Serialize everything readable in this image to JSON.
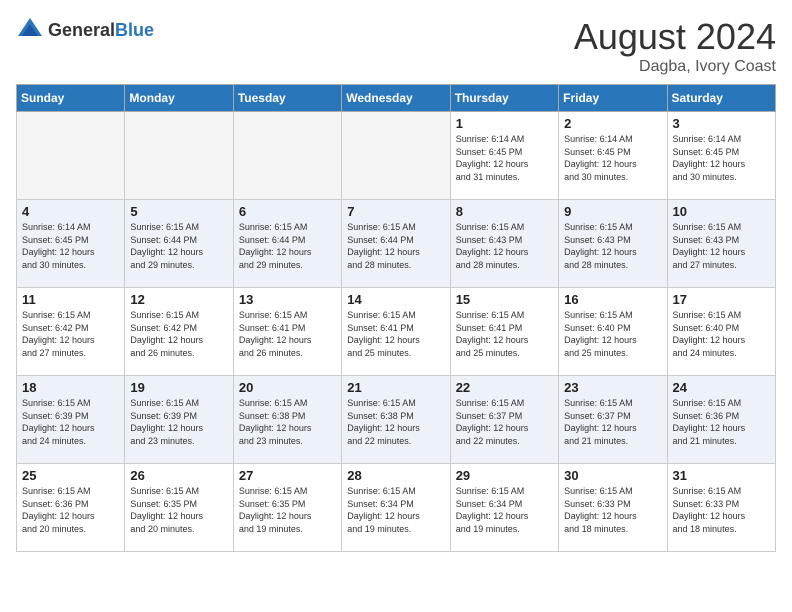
{
  "header": {
    "logo_general": "General",
    "logo_blue": "Blue",
    "month_year": "August 2024",
    "location": "Dagba, Ivory Coast"
  },
  "days_of_week": [
    "Sunday",
    "Monday",
    "Tuesday",
    "Wednesday",
    "Thursday",
    "Friday",
    "Saturday"
  ],
  "weeks": [
    [
      {
        "day": "",
        "info": ""
      },
      {
        "day": "",
        "info": ""
      },
      {
        "day": "",
        "info": ""
      },
      {
        "day": "",
        "info": ""
      },
      {
        "day": "1",
        "info": "Sunrise: 6:14 AM\nSunset: 6:45 PM\nDaylight: 12 hours\nand 31 minutes."
      },
      {
        "day": "2",
        "info": "Sunrise: 6:14 AM\nSunset: 6:45 PM\nDaylight: 12 hours\nand 30 minutes."
      },
      {
        "day": "3",
        "info": "Sunrise: 6:14 AM\nSunset: 6:45 PM\nDaylight: 12 hours\nand 30 minutes."
      }
    ],
    [
      {
        "day": "4",
        "info": "Sunrise: 6:14 AM\nSunset: 6:45 PM\nDaylight: 12 hours\nand 30 minutes."
      },
      {
        "day": "5",
        "info": "Sunrise: 6:15 AM\nSunset: 6:44 PM\nDaylight: 12 hours\nand 29 minutes."
      },
      {
        "day": "6",
        "info": "Sunrise: 6:15 AM\nSunset: 6:44 PM\nDaylight: 12 hours\nand 29 minutes."
      },
      {
        "day": "7",
        "info": "Sunrise: 6:15 AM\nSunset: 6:44 PM\nDaylight: 12 hours\nand 28 minutes."
      },
      {
        "day": "8",
        "info": "Sunrise: 6:15 AM\nSunset: 6:43 PM\nDaylight: 12 hours\nand 28 minutes."
      },
      {
        "day": "9",
        "info": "Sunrise: 6:15 AM\nSunset: 6:43 PM\nDaylight: 12 hours\nand 28 minutes."
      },
      {
        "day": "10",
        "info": "Sunrise: 6:15 AM\nSunset: 6:43 PM\nDaylight: 12 hours\nand 27 minutes."
      }
    ],
    [
      {
        "day": "11",
        "info": "Sunrise: 6:15 AM\nSunset: 6:42 PM\nDaylight: 12 hours\nand 27 minutes."
      },
      {
        "day": "12",
        "info": "Sunrise: 6:15 AM\nSunset: 6:42 PM\nDaylight: 12 hours\nand 26 minutes."
      },
      {
        "day": "13",
        "info": "Sunrise: 6:15 AM\nSunset: 6:41 PM\nDaylight: 12 hours\nand 26 minutes."
      },
      {
        "day": "14",
        "info": "Sunrise: 6:15 AM\nSunset: 6:41 PM\nDaylight: 12 hours\nand 25 minutes."
      },
      {
        "day": "15",
        "info": "Sunrise: 6:15 AM\nSunset: 6:41 PM\nDaylight: 12 hours\nand 25 minutes."
      },
      {
        "day": "16",
        "info": "Sunrise: 6:15 AM\nSunset: 6:40 PM\nDaylight: 12 hours\nand 25 minutes."
      },
      {
        "day": "17",
        "info": "Sunrise: 6:15 AM\nSunset: 6:40 PM\nDaylight: 12 hours\nand 24 minutes."
      }
    ],
    [
      {
        "day": "18",
        "info": "Sunrise: 6:15 AM\nSunset: 6:39 PM\nDaylight: 12 hours\nand 24 minutes."
      },
      {
        "day": "19",
        "info": "Sunrise: 6:15 AM\nSunset: 6:39 PM\nDaylight: 12 hours\nand 23 minutes."
      },
      {
        "day": "20",
        "info": "Sunrise: 6:15 AM\nSunset: 6:38 PM\nDaylight: 12 hours\nand 23 minutes."
      },
      {
        "day": "21",
        "info": "Sunrise: 6:15 AM\nSunset: 6:38 PM\nDaylight: 12 hours\nand 22 minutes."
      },
      {
        "day": "22",
        "info": "Sunrise: 6:15 AM\nSunset: 6:37 PM\nDaylight: 12 hours\nand 22 minutes."
      },
      {
        "day": "23",
        "info": "Sunrise: 6:15 AM\nSunset: 6:37 PM\nDaylight: 12 hours\nand 21 minutes."
      },
      {
        "day": "24",
        "info": "Sunrise: 6:15 AM\nSunset: 6:36 PM\nDaylight: 12 hours\nand 21 minutes."
      }
    ],
    [
      {
        "day": "25",
        "info": "Sunrise: 6:15 AM\nSunset: 6:36 PM\nDaylight: 12 hours\nand 20 minutes."
      },
      {
        "day": "26",
        "info": "Sunrise: 6:15 AM\nSunset: 6:35 PM\nDaylight: 12 hours\nand 20 minutes."
      },
      {
        "day": "27",
        "info": "Sunrise: 6:15 AM\nSunset: 6:35 PM\nDaylight: 12 hours\nand 19 minutes."
      },
      {
        "day": "28",
        "info": "Sunrise: 6:15 AM\nSunset: 6:34 PM\nDaylight: 12 hours\nand 19 minutes."
      },
      {
        "day": "29",
        "info": "Sunrise: 6:15 AM\nSunset: 6:34 PM\nDaylight: 12 hours\nand 19 minutes."
      },
      {
        "day": "30",
        "info": "Sunrise: 6:15 AM\nSunset: 6:33 PM\nDaylight: 12 hours\nand 18 minutes."
      },
      {
        "day": "31",
        "info": "Sunrise: 6:15 AM\nSunset: 6:33 PM\nDaylight: 12 hours\nand 18 minutes."
      }
    ]
  ]
}
